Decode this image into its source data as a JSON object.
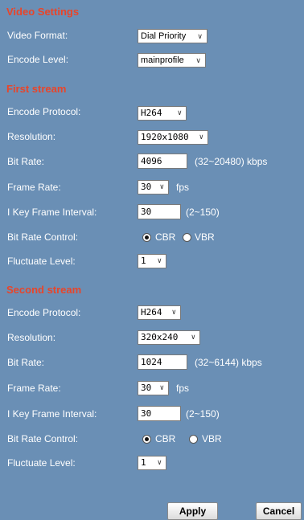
{
  "video_settings": {
    "title": "Video Settings",
    "video_format": {
      "label": "Video Format:",
      "value": "Dial Priority"
    },
    "encode_level": {
      "label": "Encode Level:",
      "value": "mainprofile"
    }
  },
  "first_stream": {
    "title": "First stream",
    "encode_protocol": {
      "label": "Encode Protocol:",
      "value": "H264"
    },
    "resolution": {
      "label": "Resolution:",
      "value": "1920x1080"
    },
    "bit_rate": {
      "label": "Bit Rate:",
      "value": "4096",
      "range": "(32~20480) kbps"
    },
    "frame_rate": {
      "label": "Frame Rate:",
      "value": "30",
      "unit": "fps"
    },
    "key_frame_interval": {
      "label": "I Key Frame Interval:",
      "value": "30",
      "range": "(2~150)"
    },
    "bit_rate_control": {
      "label": "Bit Rate Control:",
      "option_cbr": "CBR",
      "option_vbr": "VBR",
      "selected": "CBR"
    },
    "fluctuate_level": {
      "label": "Fluctuate Level:",
      "value": "1"
    }
  },
  "second_stream": {
    "title": "Second stream",
    "encode_protocol": {
      "label": "Encode Protocol:",
      "value": "H264"
    },
    "resolution": {
      "label": "Resolution:",
      "value": "320x240"
    },
    "bit_rate": {
      "label": "Bit Rate:",
      "value": "1024",
      "range": "(32~6144) kbps"
    },
    "frame_rate": {
      "label": "Frame Rate:",
      "value": "30",
      "unit": "fps"
    },
    "key_frame_interval": {
      "label": "I Key Frame Interval:",
      "value": "30",
      "range": "(2~150)"
    },
    "bit_rate_control": {
      "label": "Bit Rate Control:",
      "option_cbr": "CBR",
      "option_vbr": "VBR",
      "selected": "CBR"
    },
    "fluctuate_level": {
      "label": "Fluctuate Level:",
      "value": "1"
    }
  },
  "buttons": {
    "apply": "Apply",
    "cancel": "Cancel"
  },
  "colors": {
    "background": "#6a8fb5",
    "section_title": "#e8452a",
    "text": "#ffffff"
  },
  "icons": {
    "dropdown": "chevron-down-icon",
    "radio": "radio-icon"
  }
}
